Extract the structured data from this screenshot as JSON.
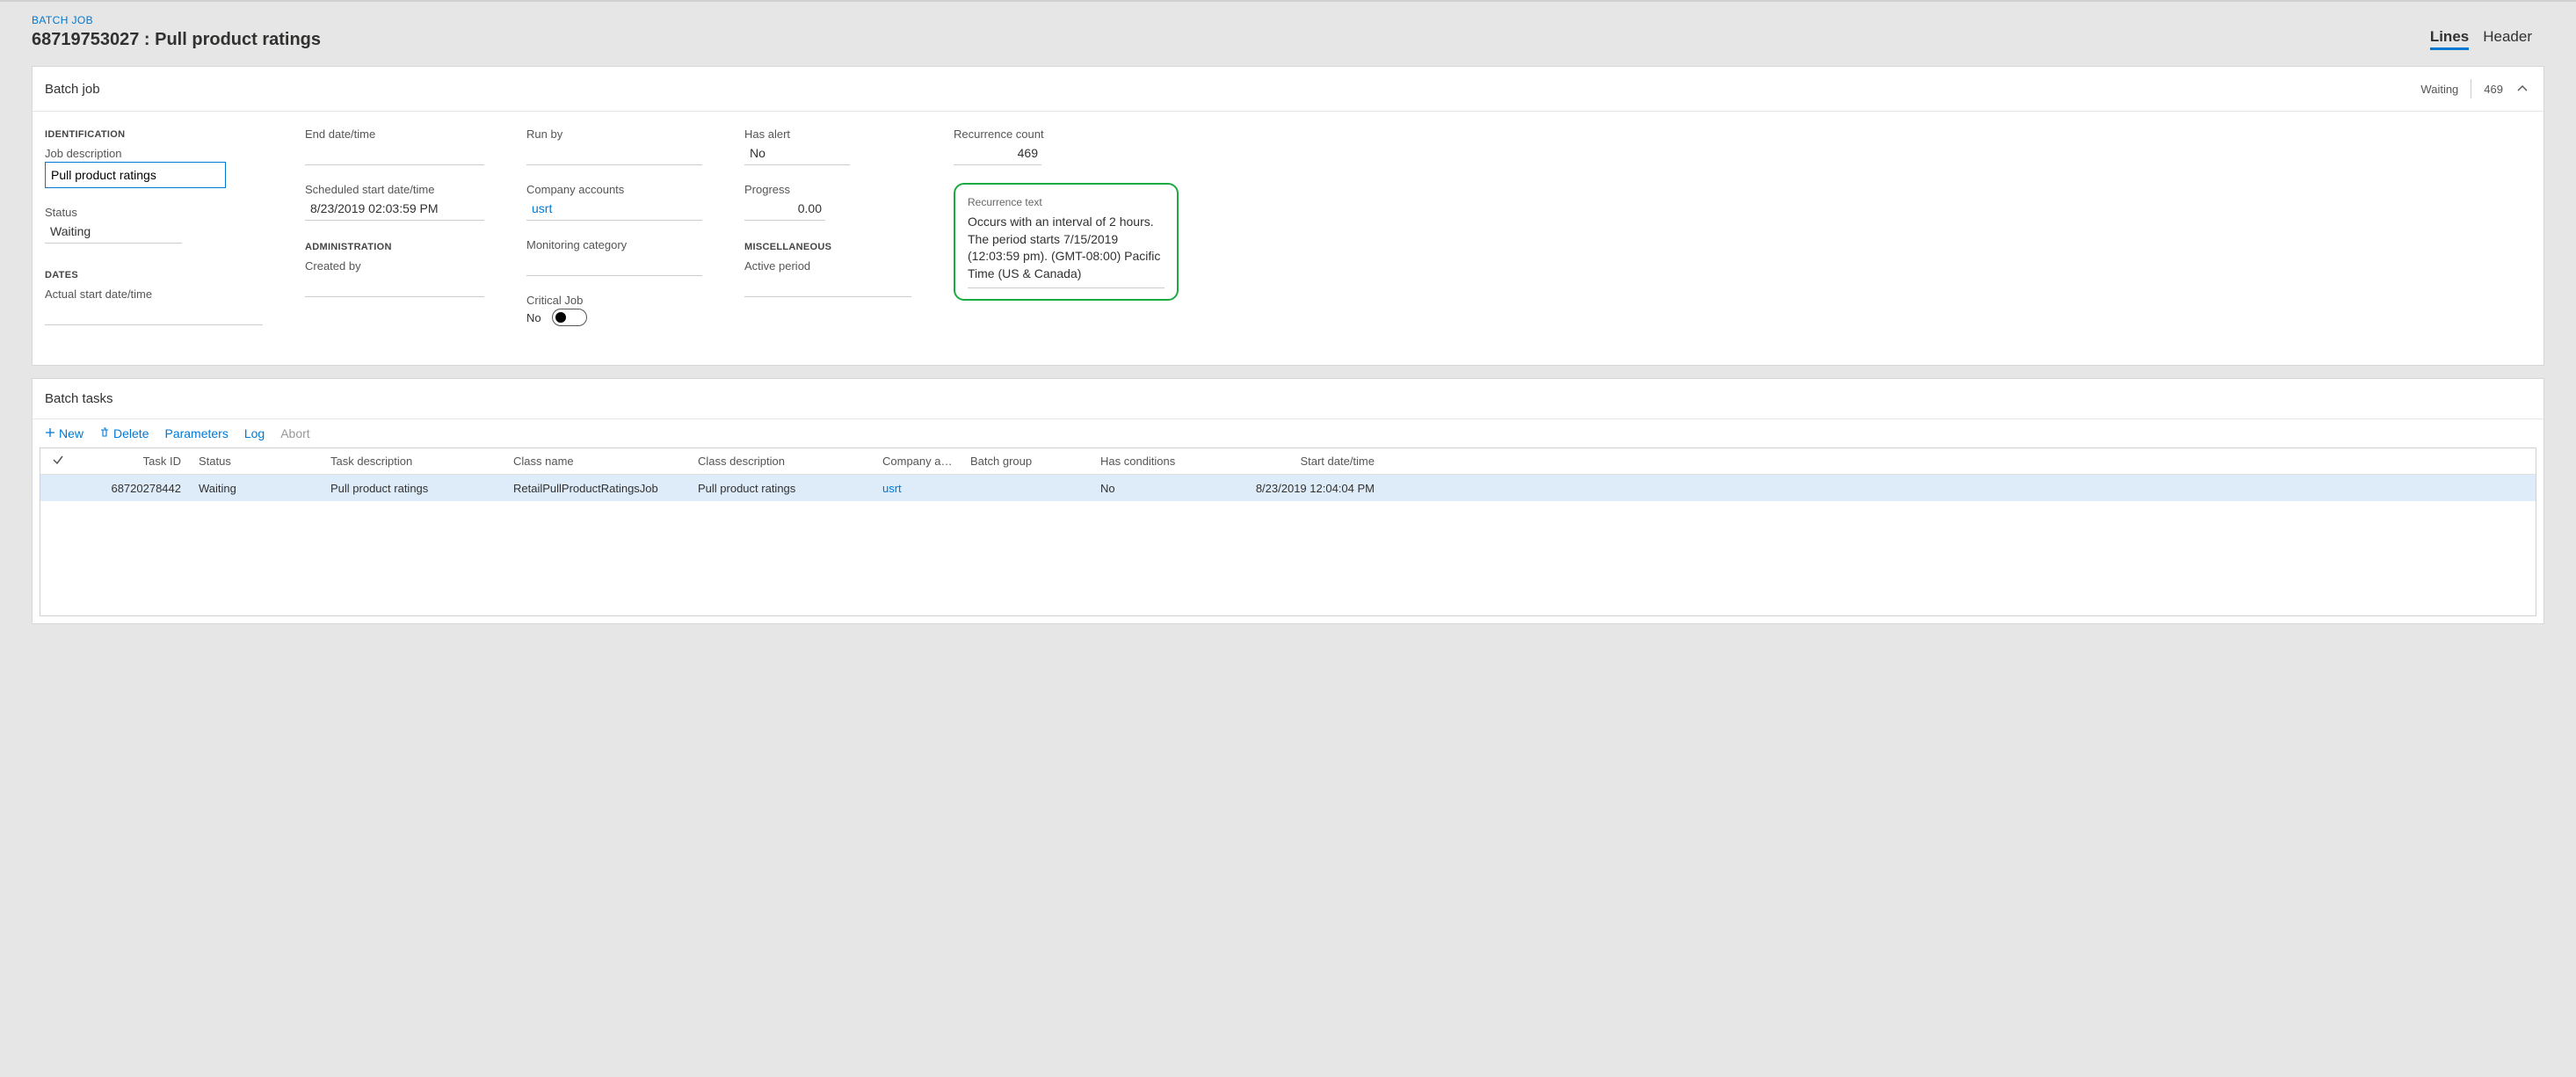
{
  "breadcrumb": "BATCH JOB",
  "page_title": "68719753027 : Pull product ratings",
  "view_tabs": {
    "lines": "Lines",
    "header": "Header"
  },
  "batch_job_card": {
    "title": "Batch job",
    "status_chip": "Waiting",
    "count_chip": "469"
  },
  "sections": {
    "identification": "IDENTIFICATION",
    "dates": "DATES",
    "administration": "ADMINISTRATION",
    "miscellaneous": "MISCELLANEOUS"
  },
  "fields": {
    "job_description": {
      "label": "Job description",
      "value": "Pull product ratings"
    },
    "status": {
      "label": "Status",
      "value": "Waiting"
    },
    "actual_start": {
      "label": "Actual start date/time",
      "value": ""
    },
    "end_datetime": {
      "label": "End date/time",
      "value": ""
    },
    "scheduled_start": {
      "label": "Scheduled start date/time",
      "value": "8/23/2019 02:03:59 PM"
    },
    "created_by": {
      "label": "Created by",
      "value": ""
    },
    "run_by": {
      "label": "Run by",
      "value": ""
    },
    "company_accounts": {
      "label": "Company accounts",
      "value": "usrt"
    },
    "monitoring_category": {
      "label": "Monitoring category",
      "value": ""
    },
    "critical_job": {
      "label": "Critical Job",
      "value": "No"
    },
    "has_alert": {
      "label": "Has alert",
      "value": "No"
    },
    "progress": {
      "label": "Progress",
      "value": "0.00"
    },
    "active_period": {
      "label": "Active period",
      "value": ""
    },
    "recurrence_count": {
      "label": "Recurrence count",
      "value": "469"
    },
    "recurrence_text": {
      "label": "Recurrence text",
      "value": "Occurs with an interval of 2 hours. The period starts 7/15/2019 (12:03:59 pm). (GMT-08:00) Pacific Time (US & Canada)"
    }
  },
  "batch_tasks_card": {
    "title": "Batch tasks"
  },
  "toolbar": {
    "new": "New",
    "delete": "Delete",
    "parameters": "Parameters",
    "log": "Log",
    "abort": "Abort"
  },
  "grid": {
    "headers": {
      "task_id": "Task ID",
      "status": "Status",
      "task_desc": "Task description",
      "class_name": "Class name",
      "class_desc": "Class description",
      "company": "Company acc...",
      "batch_group": "Batch group",
      "has_conditions": "Has conditions",
      "start_dt": "Start date/time"
    },
    "rows": [
      {
        "task_id": "68720278442",
        "status": "Waiting",
        "task_desc": "Pull product ratings",
        "class_name": "RetailPullProductRatingsJob",
        "class_desc": "Pull product ratings",
        "company": "usrt",
        "batch_group": "",
        "has_conditions": "No",
        "start_dt": "8/23/2019 12:04:04 PM"
      }
    ]
  }
}
